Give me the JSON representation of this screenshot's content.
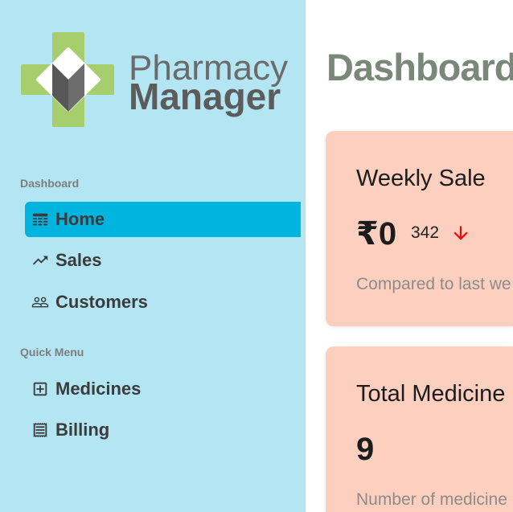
{
  "sidebar": {
    "logo": {
      "line1": "Pharmacy",
      "line2": "Manager"
    },
    "sections": [
      {
        "label": "Dashboard",
        "items": [
          {
            "label": "Home",
            "icon": "table-icon",
            "active": true
          },
          {
            "label": "Sales",
            "icon": "trending-up-icon",
            "active": false
          },
          {
            "label": "Customers",
            "icon": "people-icon",
            "active": false
          }
        ]
      },
      {
        "label": "Quick Menu",
        "items": [
          {
            "label": "Medicines",
            "icon": "add-box-icon",
            "active": false
          },
          {
            "label": "Billing",
            "icon": "receipt-icon",
            "active": false
          }
        ]
      }
    ]
  },
  "main": {
    "title": "Dashboard",
    "cards": [
      {
        "title": "Weekly Sale",
        "value": "₹0",
        "change": 342,
        "trend_icon": "arrow-down-icon",
        "note": "Compared to last we"
      },
      {
        "title": "Total Medicine",
        "value": 9,
        "note": "Number of medicine"
      }
    ]
  },
  "colors": {
    "sidebar_bg": "#b3e5f3",
    "active_bg": "#00b4e0",
    "card_bg": "#fccfbf",
    "title_color": "#7a887a",
    "trend_color": "#ff0000",
    "logo_cross": "#a6ce6c",
    "logo_mark_dark": "#575757",
    "logo_mark_light": "#6d6d6d"
  }
}
